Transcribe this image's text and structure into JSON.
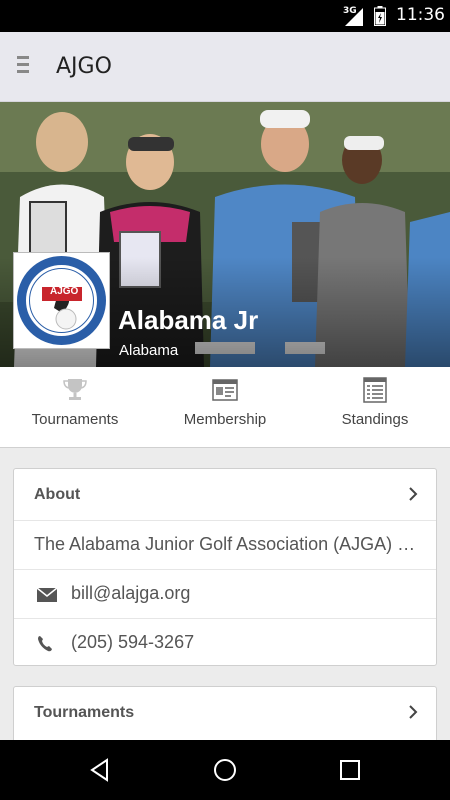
{
  "status_bar": {
    "network": "3G",
    "time": "11:36"
  },
  "app_bar": {
    "title": "AJGO",
    "menu_icon": "hamburger-icon"
  },
  "hero": {
    "org_name": "Alabama Jr",
    "org_state": "Alabama",
    "logo_text_ring": "ALABAMA JUNIOR GOLF ASSOCIATION",
    "logo_text_center": "AJGO"
  },
  "tabs": [
    {
      "label": "Tournaments",
      "icon": "trophy-icon"
    },
    {
      "label": "Membership",
      "icon": "id-card-icon"
    },
    {
      "label": "Standings",
      "icon": "list-icon"
    }
  ],
  "about": {
    "title": "About",
    "description": "The Alabama Junior Golf Association (AJGA) was founded to",
    "email": "bill@alajga.org",
    "phone": "(205) 594-3267"
  },
  "tournaments_section": {
    "title": "Tournaments"
  },
  "colors": {
    "accent": "#2a5ea8",
    "logo_red": "#c8252c",
    "background": "#ececec"
  }
}
